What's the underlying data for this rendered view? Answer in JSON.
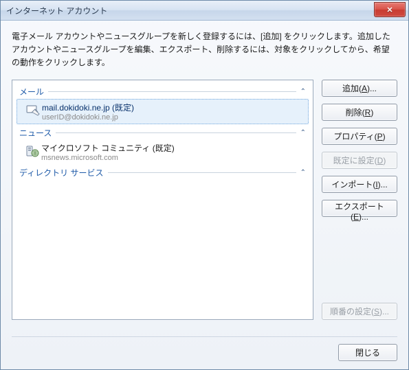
{
  "window": {
    "title": "インターネット アカウント"
  },
  "instructions": "電子メール アカウントやニュースグループを新しく登録するには、[追加] をクリックします。追加したアカウントやニュースグループを編集、エクスポート、削除するには、対象をクリックしてから、希望の動作をクリックします。",
  "sections": {
    "mail": {
      "label": "メール",
      "items": [
        {
          "title": "mail.dokidoki.ne.jp (既定)",
          "subtitle": "userID@dokidoki.ne.jp",
          "selected": true
        }
      ]
    },
    "news": {
      "label": "ニュース",
      "items": [
        {
          "title": "マイクロソフト コミュニティ (既定)",
          "subtitle": "msnews.microsoft.com",
          "selected": false
        }
      ]
    },
    "directory": {
      "label": "ディレクトリ サービス",
      "items": []
    }
  },
  "buttons": {
    "add": {
      "pre": "追加(",
      "mn": "A",
      "post": ")..."
    },
    "remove": {
      "pre": "削除(",
      "mn": "R",
      "post": ")"
    },
    "properties": {
      "pre": "プロパティ(",
      "mn": "P",
      "post": ")"
    },
    "set_default": {
      "pre": "既定に設定(",
      "mn": "D",
      "post": ")"
    },
    "import": {
      "pre": "インポート(",
      "mn": "I",
      "post": ")..."
    },
    "export": {
      "pre": "エクスポート(",
      "mn": "E",
      "post": ")..."
    },
    "set_order": {
      "pre": "順番の設定(",
      "mn": "S",
      "post": ")..."
    },
    "close": "閉じる"
  }
}
